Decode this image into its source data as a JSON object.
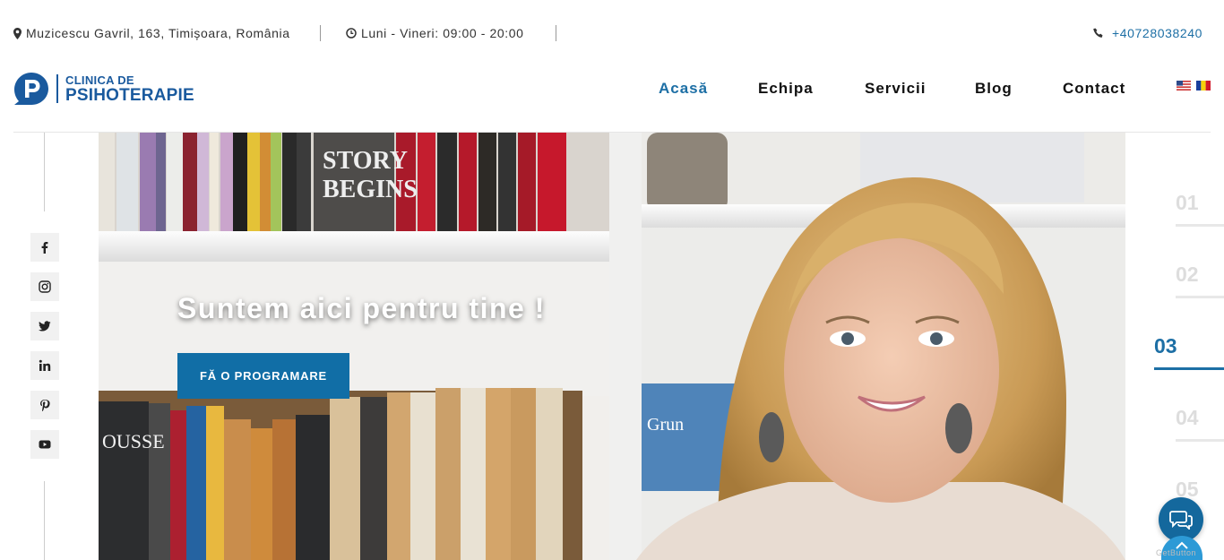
{
  "topbar": {
    "address": "Muzicescu Gavril, 163, Timișoara, România",
    "hours": "Luni - Vineri: 09:00 - 20:00",
    "phone": "+40728038240",
    "icons": [
      "map-marker-icon",
      "clock-icon",
      "phone-icon"
    ]
  },
  "logo": {
    "line1": "CLINICA DE",
    "line2": "PSIHOTERAPIE",
    "color": "#1a5a9e"
  },
  "nav": {
    "items": [
      {
        "label": "Acasă",
        "active": true
      },
      {
        "label": "Echipa",
        "active": false
      },
      {
        "label": "Servicii",
        "active": false
      },
      {
        "label": "Blog",
        "active": false
      },
      {
        "label": "Contact",
        "active": false
      }
    ],
    "languages": [
      "english-flag-icon",
      "romanian-flag-icon"
    ]
  },
  "social": [
    "facebook-icon",
    "instagram-icon",
    "twitter-icon",
    "linkedin-icon",
    "pinterest-icon",
    "youtube-icon"
  ],
  "hero": {
    "title": "Suntem aici pentru tine !",
    "button_label": "FĂ O PROGRAMARE",
    "accent": "#116ea6"
  },
  "slider": {
    "slides": [
      "01",
      "02",
      "03",
      "04",
      "05"
    ],
    "active_index": 2
  },
  "widget": {
    "chat_icon": "chat-bubbles-icon",
    "scroll_icon": "chevron-up-icon",
    "getbutton_label": "GetButton"
  }
}
